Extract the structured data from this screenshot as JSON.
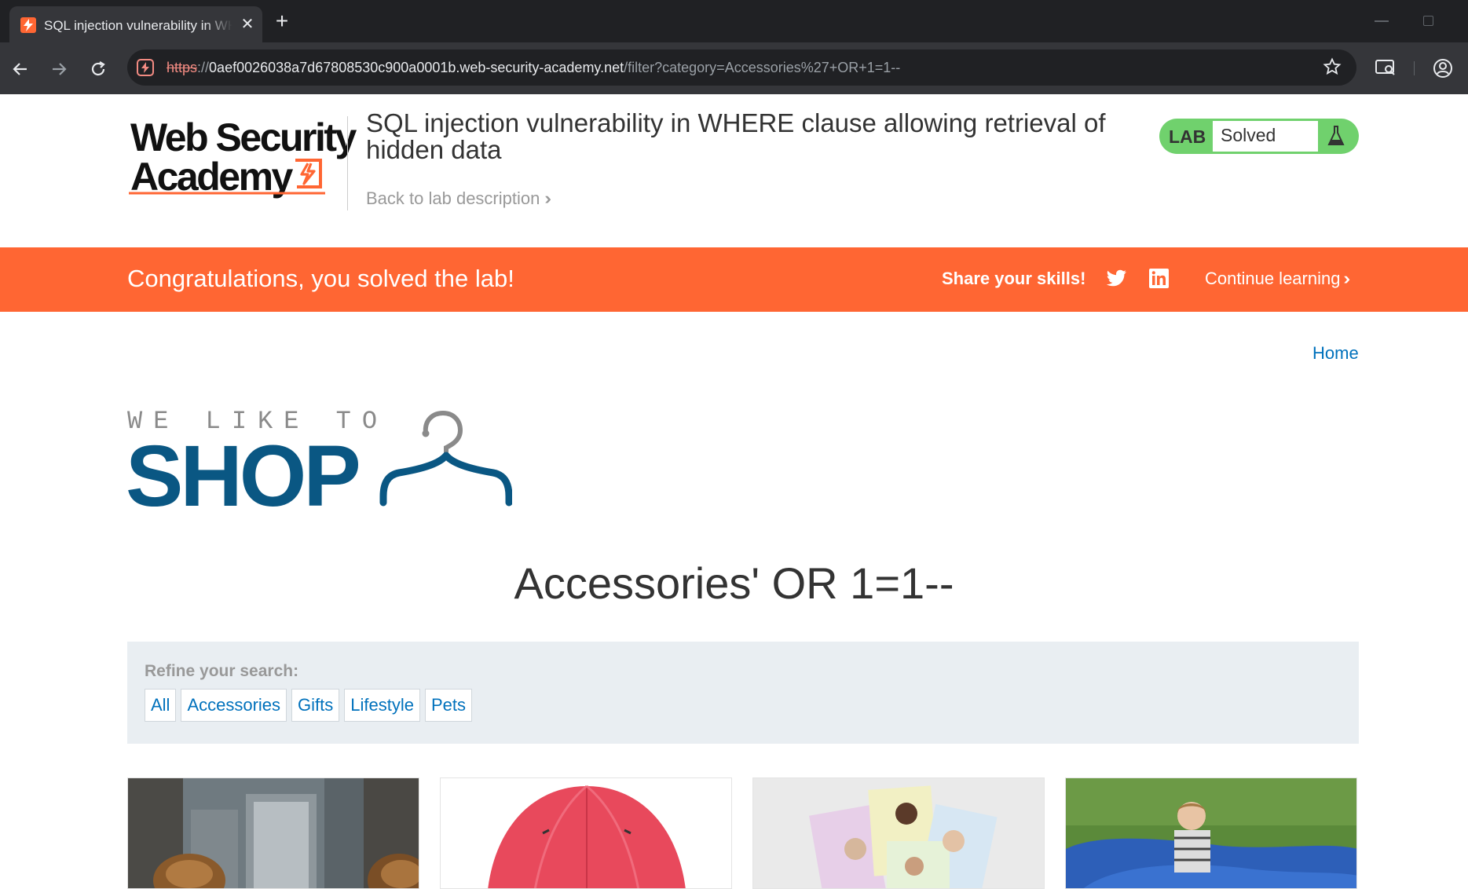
{
  "browser": {
    "tab_title": "SQL injection vulnerability in WHERE clause allowing retrieval of hidden data",
    "url_scheme": "https",
    "url_sep": "://",
    "url_host": "0aef0026038a7d67808530c900a0001b.web-security-academy.net",
    "url_path": "/filter?category=Accessories%27+OR+1=1--",
    "new_tab_glyph": "+",
    "close_glyph": "✕"
  },
  "header": {
    "logo_line1": "Web Security",
    "logo_line2": "Academy",
    "lab_title": "SQL injection vulnerability in WHERE clause allowing retrieval of hidden data",
    "back_link": "Back to lab description",
    "badge_label": "LAB",
    "badge_status": "Solved"
  },
  "banner": {
    "message": "Congratulations, you solved the lab!",
    "share": "Share your skills!",
    "continue": "Continue learning"
  },
  "shop": {
    "home_link": "Home",
    "logo_small": "WE LIKE TO",
    "logo_big": "SHOP",
    "category_heading": "Accessories' OR 1=1--",
    "refine_label": "Refine your search:",
    "filters": [
      "All",
      "Accessories",
      "Gifts",
      "Lifestyle",
      "Pets"
    ]
  },
  "colors": {
    "accent_orange": "#ff6633",
    "link_blue": "#0071bc",
    "shop_blue": "#0a5783",
    "solved_green": "#70d16d",
    "refine_bg": "#e9eef2"
  },
  "icons": [
    "burp-favicon",
    "close-icon",
    "back-arrow-icon",
    "forward-arrow-icon",
    "reload-icon",
    "bookmark-star-icon",
    "cast-icon",
    "profile-icon",
    "flask-icon",
    "twitter-icon",
    "linkedin-icon",
    "hanger-icon"
  ]
}
